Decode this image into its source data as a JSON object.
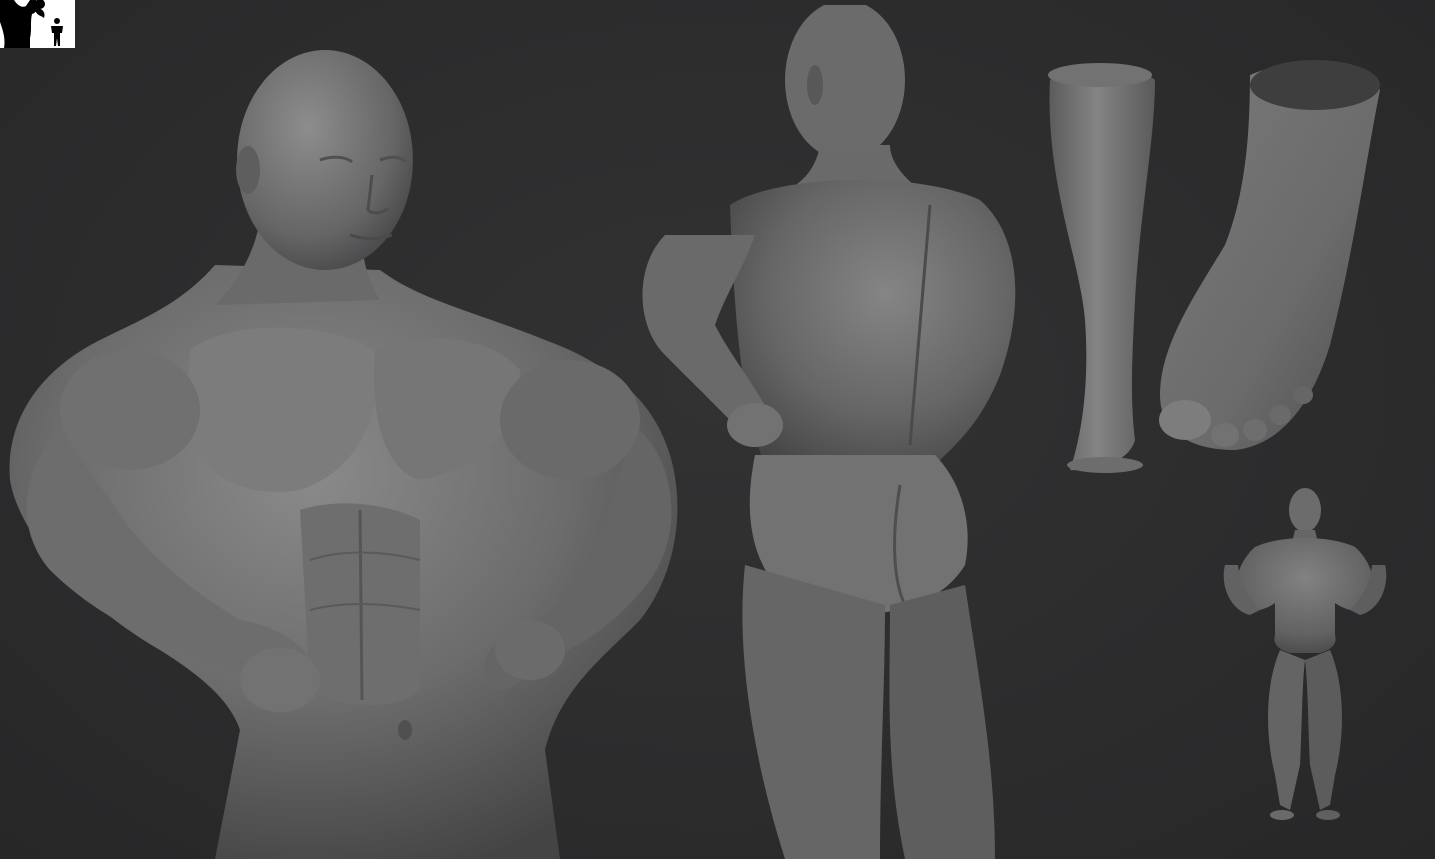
{
  "scene": {
    "background_color": "#2c2c2d",
    "sculpt_color": "#6f6f70",
    "thumbnail_background": "#ffffff",
    "thumbnail_silhouette_color": "#000000"
  },
  "views": [
    {
      "name": "front-torso-closeup",
      "icon": "sculpt-front-torso"
    },
    {
      "name": "back-view",
      "icon": "sculpt-back"
    },
    {
      "name": "leg-study",
      "icon": "sculpt-leg"
    },
    {
      "name": "foot-study",
      "icon": "sculpt-foot"
    },
    {
      "name": "full-body-front",
      "icon": "sculpt-full-body"
    }
  ]
}
